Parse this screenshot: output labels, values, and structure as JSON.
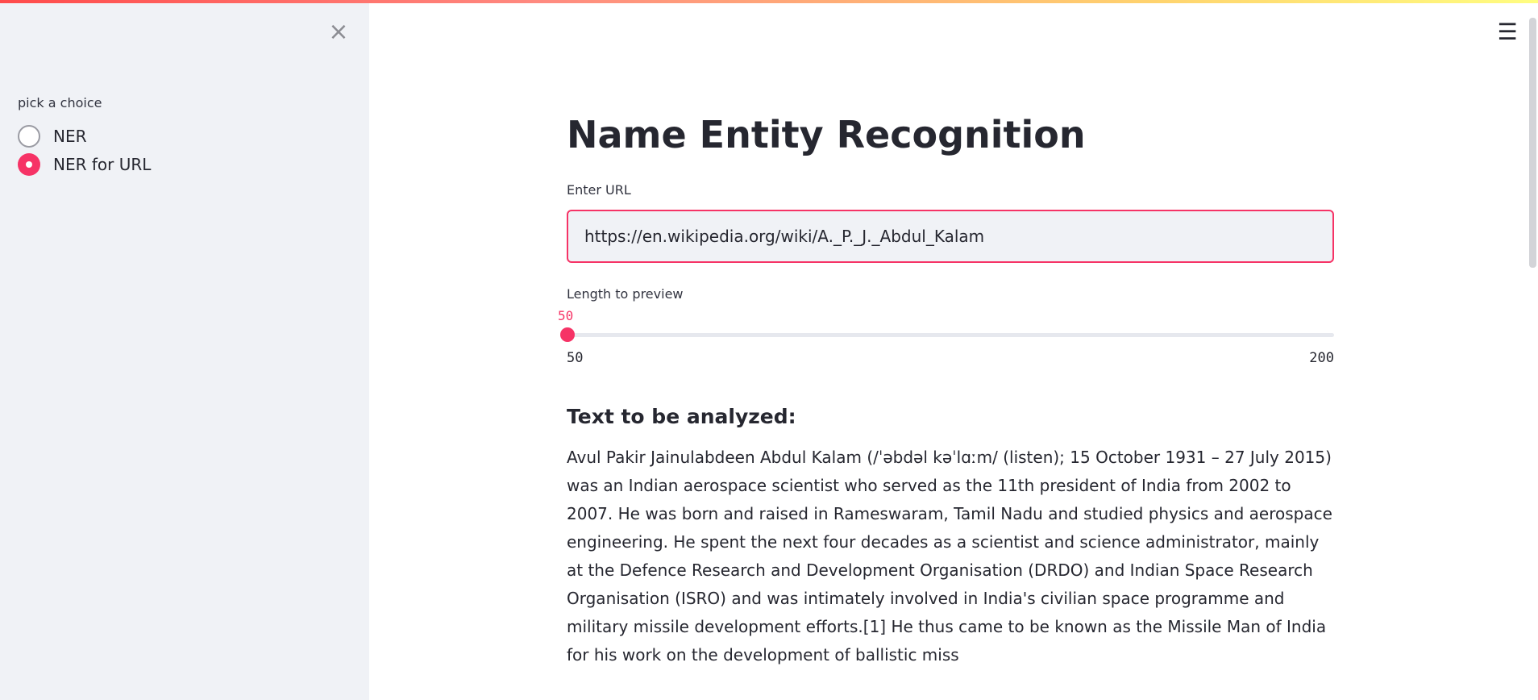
{
  "sidebar": {
    "close_icon": "×",
    "radio_label": "pick a choice",
    "options": [
      {
        "label": "NER",
        "selected": false
      },
      {
        "label": "NER for URL",
        "selected": true
      }
    ]
  },
  "header": {
    "menu_icon": "☰"
  },
  "main": {
    "title": "Name Entity Recognition",
    "url_label": "Enter URL",
    "url_value": "https://en.wikipedia.org/wiki/A._P._J._Abdul_Kalam",
    "slider_label": "Length to preview",
    "slider_value": "50",
    "slider_min": "50",
    "slider_max": "200",
    "subheader": "Text to be analyzed:",
    "text": "Avul Pakir Jainulabdeen Abdul Kalam (/ˈəbdəl kəˈlɑːm/ (listen); 15 October 1931 – 27 July 2015) was an Indian aerospace scientist who served as the 11th president of India from 2002 to 2007. He was born and raised in Rameswaram, Tamil Nadu and studied physics and aerospace engineering. He spent the next four decades as a scientist and science administrator, mainly at the Defence Research and Development Organisation (DRDO) and Indian Space Research Organisation (ISRO) and was intimately involved in India's civilian space programme and military missile development efforts.[1] He thus came to be known as the Missile Man of India for his work on the development of ballistic miss"
  },
  "colors": {
    "accent": "#f63366",
    "sidebar_bg": "#f0f2f6",
    "text": "#262730"
  }
}
